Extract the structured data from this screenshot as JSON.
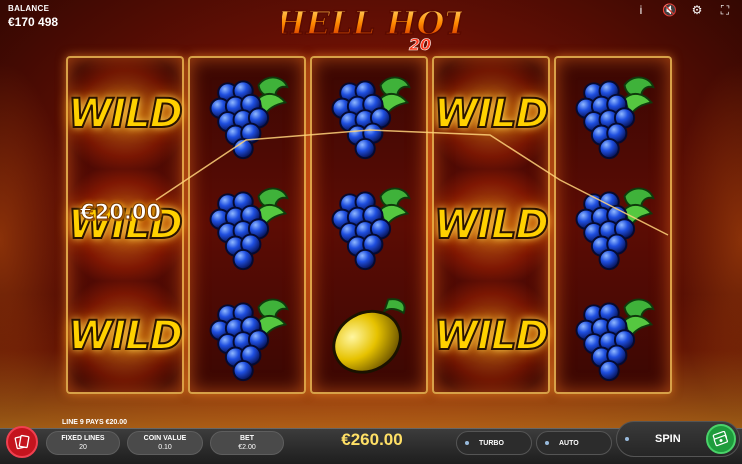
{
  "balance": {
    "label": "BALANCE",
    "value": "€170 498"
  },
  "logo": {
    "line1": "HELL HOT",
    "line2": "20"
  },
  "top_icons": [
    "info-icon",
    "sound-icon",
    "settings-icon",
    "fullscreen-icon"
  ],
  "top_glyphs": {
    "info": "i",
    "sound": "🔇",
    "settings": "⚙",
    "fullscreen": "⛶"
  },
  "reels": [
    [
      "wild",
      "wild",
      "wild"
    ],
    [
      "grapes",
      "grapes",
      "grapes"
    ],
    [
      "grapes",
      "grapes",
      "lemon"
    ],
    [
      "wild",
      "wild",
      "wild"
    ],
    [
      "grapes",
      "grapes",
      "grapes"
    ]
  ],
  "wild_label": "WILD",
  "win_amount": "€20.00",
  "line_info": "LINE 9 PAYS €20.00",
  "bottom": {
    "fixed_lines_label": "FIXED LINES",
    "fixed_lines_value": "20",
    "coin_value_label": "COIN VALUE",
    "coin_value_value": "0.10",
    "bet_label": "BET",
    "bet_value": "€2.00",
    "total_win": "€260.00",
    "turbo_label": "TURBO",
    "auto_label": "AUTO",
    "spin_label": "SPIN"
  },
  "colors": {
    "wild": "#ffd100",
    "accent_win": "#ffe066",
    "spin_green": "#1e9c3c",
    "gamble_red": "#c4141e"
  }
}
